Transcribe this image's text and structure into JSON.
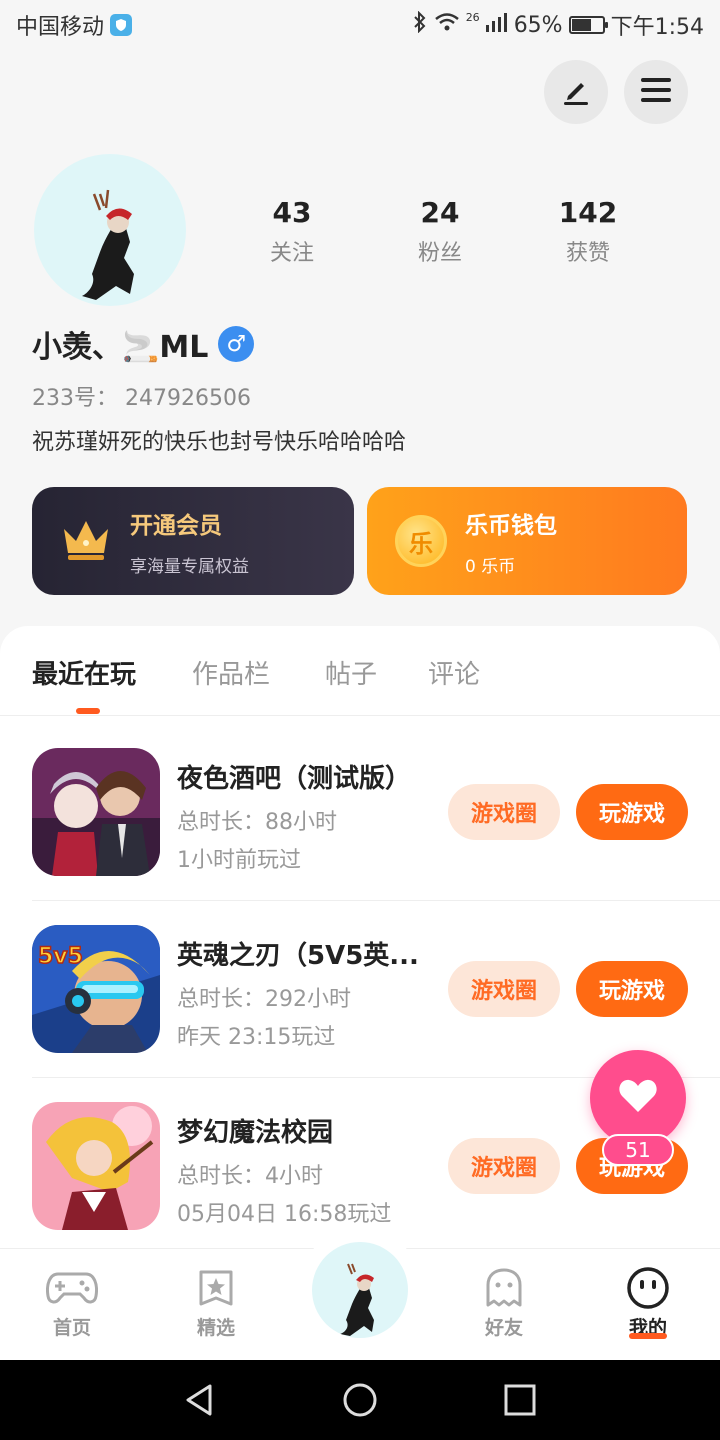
{
  "status_bar": {
    "carrier": "中国移动",
    "network": "26",
    "battery": "65%",
    "battery_level": 0.65,
    "time": "下午1:54"
  },
  "profile": {
    "stats": [
      {
        "value": "43",
        "label": "关注"
      },
      {
        "value": "24",
        "label": "粉丝"
      },
      {
        "value": "142",
        "label": "获赞"
      }
    ],
    "username": "小羡、🚬ML",
    "gender_symbol": "♂",
    "account_id": "233号： 247926506",
    "bio": "祝苏瑾妍死的快乐也封号快乐哈哈哈哈"
  },
  "cards": {
    "vip": {
      "title": "开通会员",
      "subtitle": "享海量专属权益"
    },
    "wallet": {
      "coin_char": "乐",
      "title": "乐币钱包",
      "subtitle": "0 乐币"
    }
  },
  "tabs": [
    "最近在玩",
    "作品栏",
    "帖子",
    "评论"
  ],
  "games": [
    {
      "title": "夜色酒吧（测试版）",
      "duration": "总时长：88小时",
      "last_played": "1小时前玩过",
      "circle_label": "游戏圈",
      "play_label": "玩游戏"
    },
    {
      "title": "英魂之刃（5V5英...",
      "duration": "总时长：292小时",
      "last_played": "昨天 23:15玩过",
      "circle_label": "游戏圈",
      "play_label": "玩游戏",
      "icon_text": "5v5"
    },
    {
      "title": "梦幻魔法校园",
      "duration": "总时长：4小时",
      "last_played": "05月04日 16:58玩过",
      "circle_label": "游戏圈",
      "play_label": "玩游戏"
    }
  ],
  "floating_like": {
    "count": "51"
  },
  "bottom_nav": [
    {
      "label": "首页",
      "icon": "gamepad-icon"
    },
    {
      "label": "精选",
      "icon": "star-icon"
    },
    {
      "label": "好友",
      "icon": "ghost-icon"
    },
    {
      "label": "我的",
      "icon": "smiley-icon"
    }
  ],
  "colors": {
    "accent": "#ff6a13",
    "like_pink": "#ff4d8d",
    "vip_gold": "#f6c97c",
    "gender_blue": "#3b8ef0"
  }
}
